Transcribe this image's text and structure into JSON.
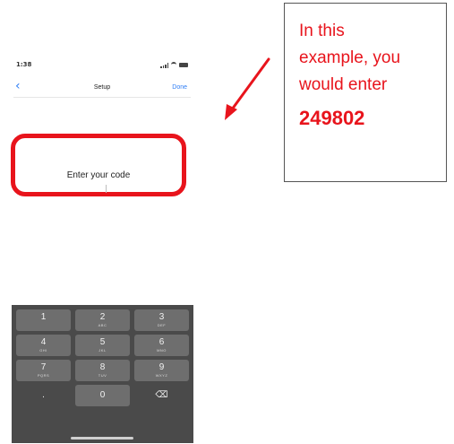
{
  "status_bar": {
    "time": "1:38"
  },
  "nav": {
    "back_glyph": "‹",
    "title": "Setup",
    "done_label": "Done"
  },
  "code_field": {
    "label": "Enter your code"
  },
  "annotation": {
    "lines": [
      "In this",
      "example, you",
      "would enter"
    ],
    "code": "249802"
  },
  "keypad": {
    "keys": [
      {
        "digit": "1",
        "letters": ""
      },
      {
        "digit": "2",
        "letters": "ABC"
      },
      {
        "digit": "3",
        "letters": "DEF"
      },
      {
        "digit": "4",
        "letters": "GHI"
      },
      {
        "digit": "5",
        "letters": "JKL"
      },
      {
        "digit": "6",
        "letters": "MNO"
      },
      {
        "digit": "7",
        "letters": "PQRS"
      },
      {
        "digit": "8",
        "letters": "TUV"
      },
      {
        "digit": "9",
        "letters": "WXYZ"
      },
      {
        "digit": ".",
        "letters": ""
      },
      {
        "digit": "0",
        "letters": ""
      },
      {
        "digit": "⌫",
        "letters": ""
      }
    ]
  },
  "colors": {
    "highlight": "#e8141c",
    "ios_blue": "#2f7ef5",
    "keypad_bg": "#4a4a4a",
    "key_bg": "#6e6e6e"
  },
  "icons": [
    "back-chevron-icon",
    "signal-icon",
    "wifi-icon",
    "battery-icon",
    "arrow-icon",
    "backspace-icon"
  ]
}
